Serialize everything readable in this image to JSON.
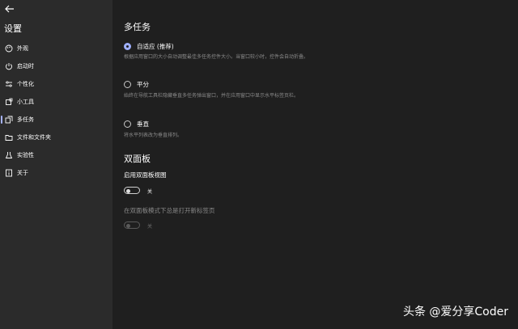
{
  "sidebar": {
    "title": "设置",
    "items": [
      {
        "label": "外观",
        "icon": "palette-icon"
      },
      {
        "label": "启动时",
        "icon": "power-icon"
      },
      {
        "label": "个性化",
        "icon": "sliders-icon"
      },
      {
        "label": "小工具",
        "icon": "puzzle-icon"
      },
      {
        "label": "多任务",
        "icon": "multitask-icon",
        "active": true
      },
      {
        "label": "文件和文件夹",
        "icon": "folder-icon"
      },
      {
        "label": "实验性",
        "icon": "flask-icon"
      },
      {
        "label": "关于",
        "icon": "info-icon"
      }
    ]
  },
  "main": {
    "multitask": {
      "title": "多任务",
      "options": [
        {
          "label": "自适应 (推荐)",
          "desc": "根据应用窗口的大小自动调整最佳多任务控件大小。当窗口较小时，控件会自动折叠。",
          "checked": true
        },
        {
          "label": "平分",
          "desc": "始终在导航工具栏隐藏垂直多任务弹出窗口，并在应用窗口中显示水平标签页栏。",
          "checked": false
        },
        {
          "label": "垂直",
          "desc": "将水平列表改为垂直排列。",
          "checked": false
        }
      ]
    },
    "dualpane": {
      "title": "双面板",
      "enable_label": "启用双面板视图",
      "enable_state": "关",
      "new_tab_label": "在双面板模式下总是打开新标签页",
      "new_tab_state": "关"
    }
  },
  "watermark": "头条 @爱分享Coder",
  "colors": {
    "accent": "#9fb0ff",
    "sidebar_bg": "#2b2b2b",
    "main_bg": "#1f1f1f"
  }
}
